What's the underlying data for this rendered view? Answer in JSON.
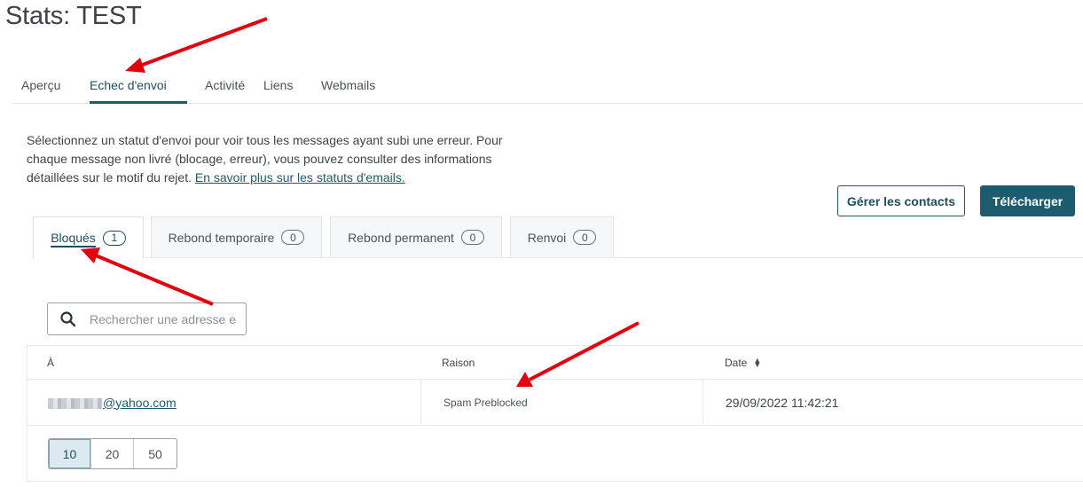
{
  "page": {
    "title": "Stats: TEST"
  },
  "top_tabs": [
    {
      "label": "Aperçu"
    },
    {
      "label": "Echec d'envoi",
      "active": true
    },
    {
      "label": "Activité"
    },
    {
      "label": "Liens"
    },
    {
      "label": "Webmails"
    }
  ],
  "intro": {
    "text": "Sélectionnez un statut d'envoi pour voir tous les messages ayant subi une erreur. Pour chaque message non livré (blocage, erreur), vous pouvez consulter des informations détaillées sur le motif du rejet. ",
    "link_label": "En savoir plus sur les statuts d'emails."
  },
  "actions": {
    "manage_contacts": "Gérer les contacts",
    "download": "Télécharger"
  },
  "sub_tabs": [
    {
      "label": "Bloqués",
      "count": "1",
      "active": true
    },
    {
      "label": "Rebond temporaire",
      "count": "0"
    },
    {
      "label": "Rebond permanent",
      "count": "0"
    },
    {
      "label": "Renvoi",
      "count": "0"
    }
  ],
  "search": {
    "placeholder": "Rechercher une adresse e-mail",
    "icon": "search-icon"
  },
  "table": {
    "columns": {
      "to": "À",
      "reason": "Raison",
      "date": "Date"
    },
    "rows": [
      {
        "email_visible": "@yahoo.com",
        "reason": "Spam Preblocked",
        "date": "29/09/2022 11:42:21"
      }
    ]
  },
  "pagination": {
    "sizes": [
      "10",
      "20",
      "50"
    ],
    "selected": "10"
  },
  "colors": {
    "accent": "#1d5b6e",
    "annotation_arrow": "#e3000f"
  }
}
